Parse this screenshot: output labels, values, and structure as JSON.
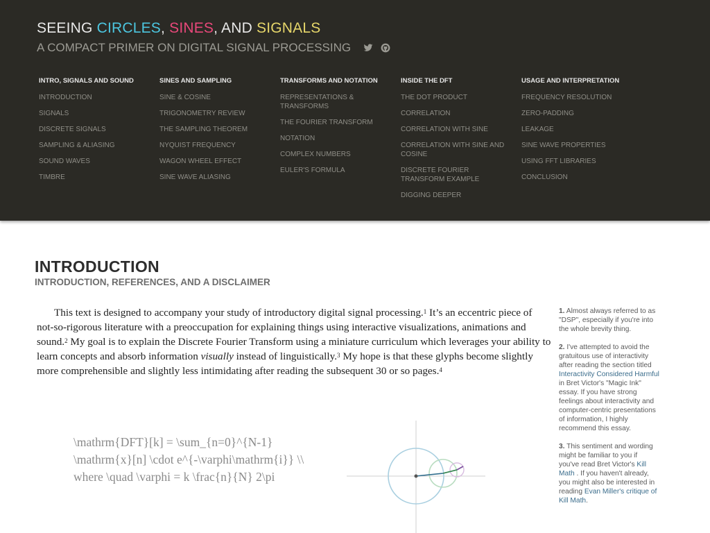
{
  "header": {
    "title_seeing": "SEEING ",
    "title_circles": "CIRCLES",
    "title_sep1": ", ",
    "title_sines": "SINES",
    "title_sep2": ", AND ",
    "title_signals": "SIGNALS",
    "subtitle": "A COMPACT PRIMER ON DIGITAL SIGNAL PROCESSING",
    "social_icons": [
      "twitter-icon",
      "github-icon"
    ]
  },
  "colors": {
    "header_bg": "#2b2a25",
    "circles": "#4cc6e0",
    "sines": "#e8487a",
    "signals": "#e6d66a"
  },
  "nav": {
    "columns": [
      {
        "heading": "INTRO, SIGNALS AND SOUND",
        "links": [
          "INTRODUCTION",
          "SIGNALS",
          "DISCRETE SIGNALS",
          "SAMPLING & ALIASING",
          "SOUND WAVES",
          "TIMBRE"
        ]
      },
      {
        "heading": "SINES AND SAMPLING",
        "links": [
          "SINE & COSINE",
          "TRIGONOMETRY REVIEW",
          "THE SAMPLING THEOREM",
          "NYQUIST FREQUENCY",
          "WAGON WHEEL EFFECT",
          "SINE WAVE ALIASING"
        ]
      },
      {
        "heading": "TRANSFORMS AND NOTATION",
        "links": [
          "REPRESENTATIONS & TRANSFORMS",
          "THE FOURIER TRANSFORM",
          "NOTATION",
          "COMPLEX NUMBERS",
          "EULER'S FORMULA"
        ]
      },
      {
        "heading": "INSIDE THE DFT",
        "links": [
          "THE DOT PRODUCT",
          "CORRELATION",
          "CORRELATION WITH SINE",
          "CORRELATION WITH SINE AND COSINE",
          "DISCRETE FOURIER TRANSFORM EXAMPLE",
          "DIGGING DEEPER"
        ]
      },
      {
        "heading": "USAGE AND INTERPRETATION",
        "links": [
          "FREQUENCY RESOLUTION",
          "ZERO-PADDING",
          "LEAKAGE",
          "SINE WAVE PROPERTIES",
          "USING FFT LIBRARIES",
          "CONCLUSION"
        ]
      }
    ]
  },
  "main": {
    "title": "INTRODUCTION",
    "subtitle": "INTRODUCTION, REFERENCES, AND A DISCLAIMER",
    "p1": "This text is designed to accompany your study of introductory digital signal processing.",
    "s1": "1",
    "p2": " It’s an eccentric piece of not-so-rigorous literature with a preoccupation for explaining things using interactive visualizations, animations and sound.",
    "s2": "2",
    "p3": " My goal is to explain the Discrete Fourier Transform using a miniature curriculum which leverages your ability to learn concepts and absorb information ",
    "p3_em": "visually",
    "p4": " instead of linguistically.",
    "s3": "3",
    "p5": " My hope is that these glyphs become slightly more comprehensible and slightly less intimidating after reading the subsequent 30 or so pages.",
    "s4": "4",
    "formula": "\\mathrm{DFT}[k] = \\sum_{n=0}^{N-1} \\mathrm{x}[n] \\cdot e^{-\\varphi\\mathrm{i}} \\\\ where \\quad \\varphi = k \\frac{n}{N} 2\\pi"
  },
  "sidenotes": {
    "n1": {
      "num": "1.",
      "text": " Almost always referred to as \"DSP\", especially if you're into the whole brevity thing."
    },
    "n2": {
      "num": "2.",
      "text_a": " I've attempted to avoid the gratuitous use of interactivity after reading the section titled ",
      "link": "Interactivity Considered Harmful",
      "text_b": " in Bret Victor's \"Magic Ink\" essay. If you have strong feelings about interactivity and computer-centric presentations of information, I highly recommend this essay."
    },
    "n3": {
      "num": "3.",
      "text_a": " This sentiment and wording might be familiar to you if you've read Bret Victor's ",
      "link_a": "Kill Math",
      "text_b": " . If you haven't already, you might also be interested in reading ",
      "link_b": "Evan Miller's",
      "text_c": " ",
      "link_c": "critique of Kill Math",
      "text_d": "."
    }
  }
}
